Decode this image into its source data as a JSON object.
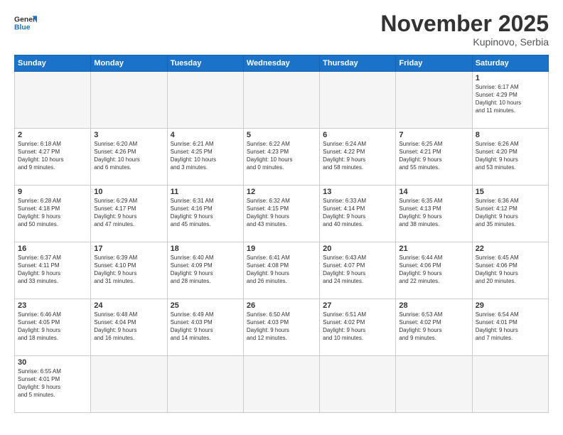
{
  "logo": {
    "text_general": "General",
    "text_blue": "Blue"
  },
  "header": {
    "month_title": "November 2025",
    "subtitle": "Kupinovo, Serbia"
  },
  "weekdays": [
    "Sunday",
    "Monday",
    "Tuesday",
    "Wednesday",
    "Thursday",
    "Friday",
    "Saturday"
  ],
  "weeks": [
    [
      {
        "day": "",
        "info": ""
      },
      {
        "day": "",
        "info": ""
      },
      {
        "day": "",
        "info": ""
      },
      {
        "day": "",
        "info": ""
      },
      {
        "day": "",
        "info": ""
      },
      {
        "day": "",
        "info": ""
      },
      {
        "day": "1",
        "info": "Sunrise: 6:17 AM\nSunset: 4:29 PM\nDaylight: 10 hours\nand 11 minutes."
      }
    ],
    [
      {
        "day": "2",
        "info": "Sunrise: 6:18 AM\nSunset: 4:27 PM\nDaylight: 10 hours\nand 9 minutes."
      },
      {
        "day": "3",
        "info": "Sunrise: 6:20 AM\nSunset: 4:26 PM\nDaylight: 10 hours\nand 6 minutes."
      },
      {
        "day": "4",
        "info": "Sunrise: 6:21 AM\nSunset: 4:25 PM\nDaylight: 10 hours\nand 3 minutes."
      },
      {
        "day": "5",
        "info": "Sunrise: 6:22 AM\nSunset: 4:23 PM\nDaylight: 10 hours\nand 0 minutes."
      },
      {
        "day": "6",
        "info": "Sunrise: 6:24 AM\nSunset: 4:22 PM\nDaylight: 9 hours\nand 58 minutes."
      },
      {
        "day": "7",
        "info": "Sunrise: 6:25 AM\nSunset: 4:21 PM\nDaylight: 9 hours\nand 55 minutes."
      },
      {
        "day": "8",
        "info": "Sunrise: 6:26 AM\nSunset: 4:20 PM\nDaylight: 9 hours\nand 53 minutes."
      }
    ],
    [
      {
        "day": "9",
        "info": "Sunrise: 6:28 AM\nSunset: 4:18 PM\nDaylight: 9 hours\nand 50 minutes."
      },
      {
        "day": "10",
        "info": "Sunrise: 6:29 AM\nSunset: 4:17 PM\nDaylight: 9 hours\nand 47 minutes."
      },
      {
        "day": "11",
        "info": "Sunrise: 6:31 AM\nSunset: 4:16 PM\nDaylight: 9 hours\nand 45 minutes."
      },
      {
        "day": "12",
        "info": "Sunrise: 6:32 AM\nSunset: 4:15 PM\nDaylight: 9 hours\nand 43 minutes."
      },
      {
        "day": "13",
        "info": "Sunrise: 6:33 AM\nSunset: 4:14 PM\nDaylight: 9 hours\nand 40 minutes."
      },
      {
        "day": "14",
        "info": "Sunrise: 6:35 AM\nSunset: 4:13 PM\nDaylight: 9 hours\nand 38 minutes."
      },
      {
        "day": "15",
        "info": "Sunrise: 6:36 AM\nSunset: 4:12 PM\nDaylight: 9 hours\nand 35 minutes."
      }
    ],
    [
      {
        "day": "16",
        "info": "Sunrise: 6:37 AM\nSunset: 4:11 PM\nDaylight: 9 hours\nand 33 minutes."
      },
      {
        "day": "17",
        "info": "Sunrise: 6:39 AM\nSunset: 4:10 PM\nDaylight: 9 hours\nand 31 minutes."
      },
      {
        "day": "18",
        "info": "Sunrise: 6:40 AM\nSunset: 4:09 PM\nDaylight: 9 hours\nand 28 minutes."
      },
      {
        "day": "19",
        "info": "Sunrise: 6:41 AM\nSunset: 4:08 PM\nDaylight: 9 hours\nand 26 minutes."
      },
      {
        "day": "20",
        "info": "Sunrise: 6:43 AM\nSunset: 4:07 PM\nDaylight: 9 hours\nand 24 minutes."
      },
      {
        "day": "21",
        "info": "Sunrise: 6:44 AM\nSunset: 4:06 PM\nDaylight: 9 hours\nand 22 minutes."
      },
      {
        "day": "22",
        "info": "Sunrise: 6:45 AM\nSunset: 4:06 PM\nDaylight: 9 hours\nand 20 minutes."
      }
    ],
    [
      {
        "day": "23",
        "info": "Sunrise: 6:46 AM\nSunset: 4:05 PM\nDaylight: 9 hours\nand 18 minutes."
      },
      {
        "day": "24",
        "info": "Sunrise: 6:48 AM\nSunset: 4:04 PM\nDaylight: 9 hours\nand 16 minutes."
      },
      {
        "day": "25",
        "info": "Sunrise: 6:49 AM\nSunset: 4:03 PM\nDaylight: 9 hours\nand 14 minutes."
      },
      {
        "day": "26",
        "info": "Sunrise: 6:50 AM\nSunset: 4:03 PM\nDaylight: 9 hours\nand 12 minutes."
      },
      {
        "day": "27",
        "info": "Sunrise: 6:51 AM\nSunset: 4:02 PM\nDaylight: 9 hours\nand 10 minutes."
      },
      {
        "day": "28",
        "info": "Sunrise: 6:53 AM\nSunset: 4:02 PM\nDaylight: 9 hours\nand 9 minutes."
      },
      {
        "day": "29",
        "info": "Sunrise: 6:54 AM\nSunset: 4:01 PM\nDaylight: 9 hours\nand 7 minutes."
      }
    ],
    [
      {
        "day": "30",
        "info": "Sunrise: 6:55 AM\nSunset: 4:01 PM\nDaylight: 9 hours\nand 5 minutes."
      },
      {
        "day": "",
        "info": ""
      },
      {
        "day": "",
        "info": ""
      },
      {
        "day": "",
        "info": ""
      },
      {
        "day": "",
        "info": ""
      },
      {
        "day": "",
        "info": ""
      },
      {
        "day": "",
        "info": ""
      }
    ]
  ]
}
